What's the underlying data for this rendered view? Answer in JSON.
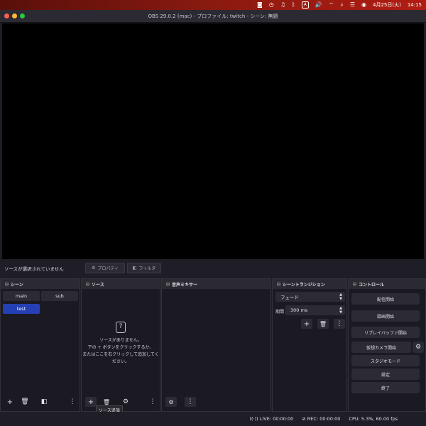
{
  "menubar": {
    "date": "4月25日(火)",
    "time": "14:15",
    "input_mode": "A"
  },
  "window": {
    "title": "OBS 29.0.2 (mac) - プロファイル: twitch - シーン: 無題"
  },
  "source_bar": {
    "status": "ソースが選択されていません",
    "properties": "プロパティ",
    "filters": "フィルタ"
  },
  "docks": {
    "scenes": {
      "title": "シーン",
      "items": [
        "main",
        "sub",
        "test"
      ],
      "selected": "test"
    },
    "sources": {
      "title": "ソース",
      "empty_lines": [
        "ソースがありません。",
        "下の + ボタンをクリックするか、",
        "またはここを右クリックして追加してく",
        "ださい。"
      ],
      "tooltip": "ソース追加"
    },
    "mixer": {
      "title": "音声ミキサー"
    },
    "transitions": {
      "title": "シーントランジション",
      "transition": "フェード",
      "duration_label": "期間",
      "duration": "300 ms"
    },
    "controls": {
      "title": "コントロール",
      "buttons": [
        "配信開始",
        "録画開始",
        "リプレイバッファ開始",
        "仮想カメラ開始",
        "スタジオモード",
        "設定",
        "終了"
      ]
    }
  },
  "status": {
    "live": "LIVE: 00:00:00",
    "rec": "REC: 00:00:00",
    "cpu": "CPU: 5.3%, 60.00 fps"
  },
  "colors": {
    "accent": "#2540b5",
    "background": "#1f1e27",
    "menubar": "#8a1a10"
  }
}
